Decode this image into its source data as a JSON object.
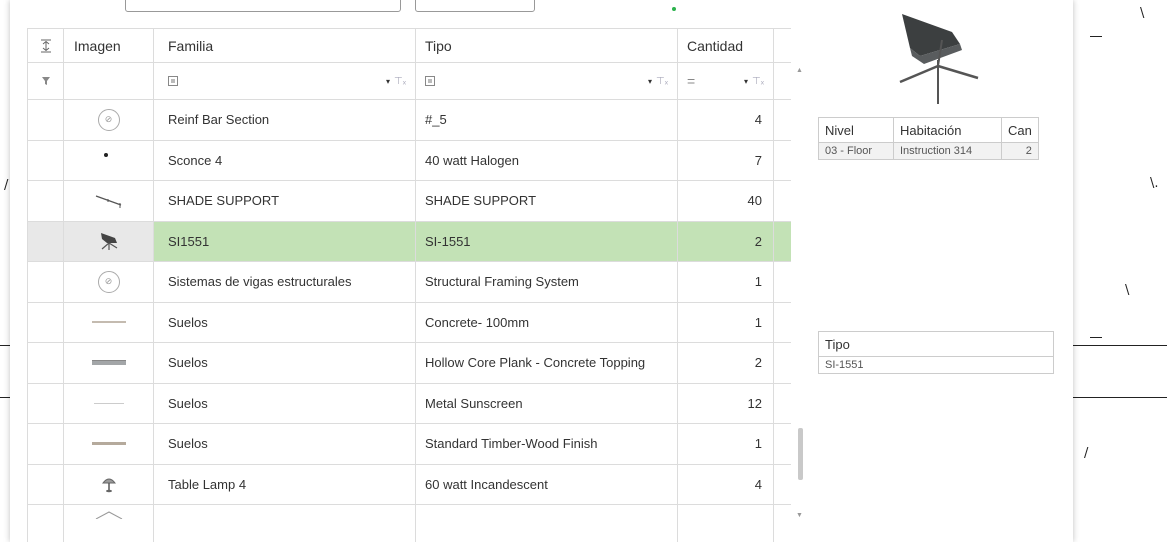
{
  "table": {
    "headers": {
      "imagen": "Imagen",
      "familia": "Familia",
      "tipo": "Tipo",
      "cantidad": "Cantidad"
    },
    "filter": {
      "eq": "=",
      "caret": "▾",
      "clear": "⊤ₓ"
    },
    "rows": [
      {
        "thumb": "no-image-icon",
        "familia": "Reinf Bar Section",
        "tipo": "#_5",
        "cantidad": "4"
      },
      {
        "thumb": "sconce-icon",
        "familia": "Sconce 4",
        "tipo": "40 watt Halogen",
        "cantidad": "7"
      },
      {
        "thumb": "shade-support-icon",
        "familia": "SHADE SUPPORT",
        "tipo": "SHADE SUPPORT",
        "cantidad": "40"
      },
      {
        "thumb": "chair-icon",
        "familia": "SI1551",
        "tipo": "SI-1551",
        "cantidad": "2",
        "selected": true
      },
      {
        "thumb": "no-image-icon",
        "familia": "Sistemas de vigas estructurales",
        "tipo": "Structural Framing System",
        "cantidad": "1"
      },
      {
        "thumb": "floor-thin-icon",
        "familia": "Suelos",
        "tipo": "Concrete- 100mm",
        "cantidad": "1"
      },
      {
        "thumb": "floor-thick-icon",
        "familia": "Suelos",
        "tipo": "Hollow Core Plank - Concrete Topping",
        "cantidad": "2"
      },
      {
        "thumb": "floor-light-icon",
        "familia": "Suelos",
        "tipo": "Metal Sunscreen",
        "cantidad": "12"
      },
      {
        "thumb": "floor-wood-icon",
        "familia": "Suelos",
        "tipo": "Standard Timber-Wood Finish",
        "cantidad": "1"
      },
      {
        "thumb": "table-lamp-icon",
        "familia": "Table Lamp 4",
        "tipo": "60 watt Incandescent",
        "cantidad": "4"
      }
    ]
  },
  "details": {
    "headers": {
      "nivel": "Nivel",
      "habitacion": "Habitación",
      "cantidad": "Can"
    },
    "row": {
      "nivel": "03 - Floor",
      "habitacion": "Instruction 314",
      "cantidad": "2"
    }
  },
  "tipo_box": {
    "header": "Tipo",
    "value": "SI-1551"
  },
  "colors": {
    "selected_row": "#c3e2b6",
    "status_dot": "#2bb24c"
  }
}
